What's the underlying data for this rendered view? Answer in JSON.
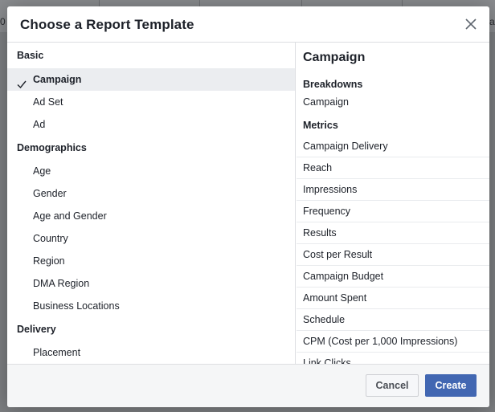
{
  "background": {
    "glyphs": [
      "0",
      "a"
    ]
  },
  "dialog": {
    "title": "Choose a Report Template",
    "close_icon": "close-icon"
  },
  "templates": {
    "sections": [
      {
        "heading": "Basic",
        "items": [
          {
            "label": "Campaign",
            "selected": true
          },
          {
            "label": "Ad Set",
            "selected": false
          },
          {
            "label": "Ad",
            "selected": false
          }
        ]
      },
      {
        "heading": "Demographics",
        "items": [
          {
            "label": "Age",
            "selected": false
          },
          {
            "label": "Gender",
            "selected": false
          },
          {
            "label": "Age and Gender",
            "selected": false
          },
          {
            "label": "Country",
            "selected": false
          },
          {
            "label": "Region",
            "selected": false
          },
          {
            "label": "DMA Region",
            "selected": false
          },
          {
            "label": "Business Locations",
            "selected": false
          }
        ]
      },
      {
        "heading": "Delivery",
        "items": [
          {
            "label": "Placement",
            "selected": false
          }
        ]
      }
    ]
  },
  "details": {
    "title": "Campaign",
    "breakdowns_heading": "Breakdowns",
    "breakdowns": [
      "Campaign"
    ],
    "metrics_heading": "Metrics",
    "metrics": [
      "Campaign Delivery",
      "Reach",
      "Impressions",
      "Frequency",
      "Results",
      "Cost per Result",
      "Campaign Budget",
      "Amount Spent",
      "Schedule",
      "CPM (Cost per 1,000 Impressions)",
      "Link Clicks"
    ]
  },
  "footer": {
    "cancel_label": "Cancel",
    "create_label": "Create"
  },
  "colors": {
    "primary_button": "#4267b2",
    "selected_row": "#ebedf0",
    "overlay": "#7d7f82"
  }
}
